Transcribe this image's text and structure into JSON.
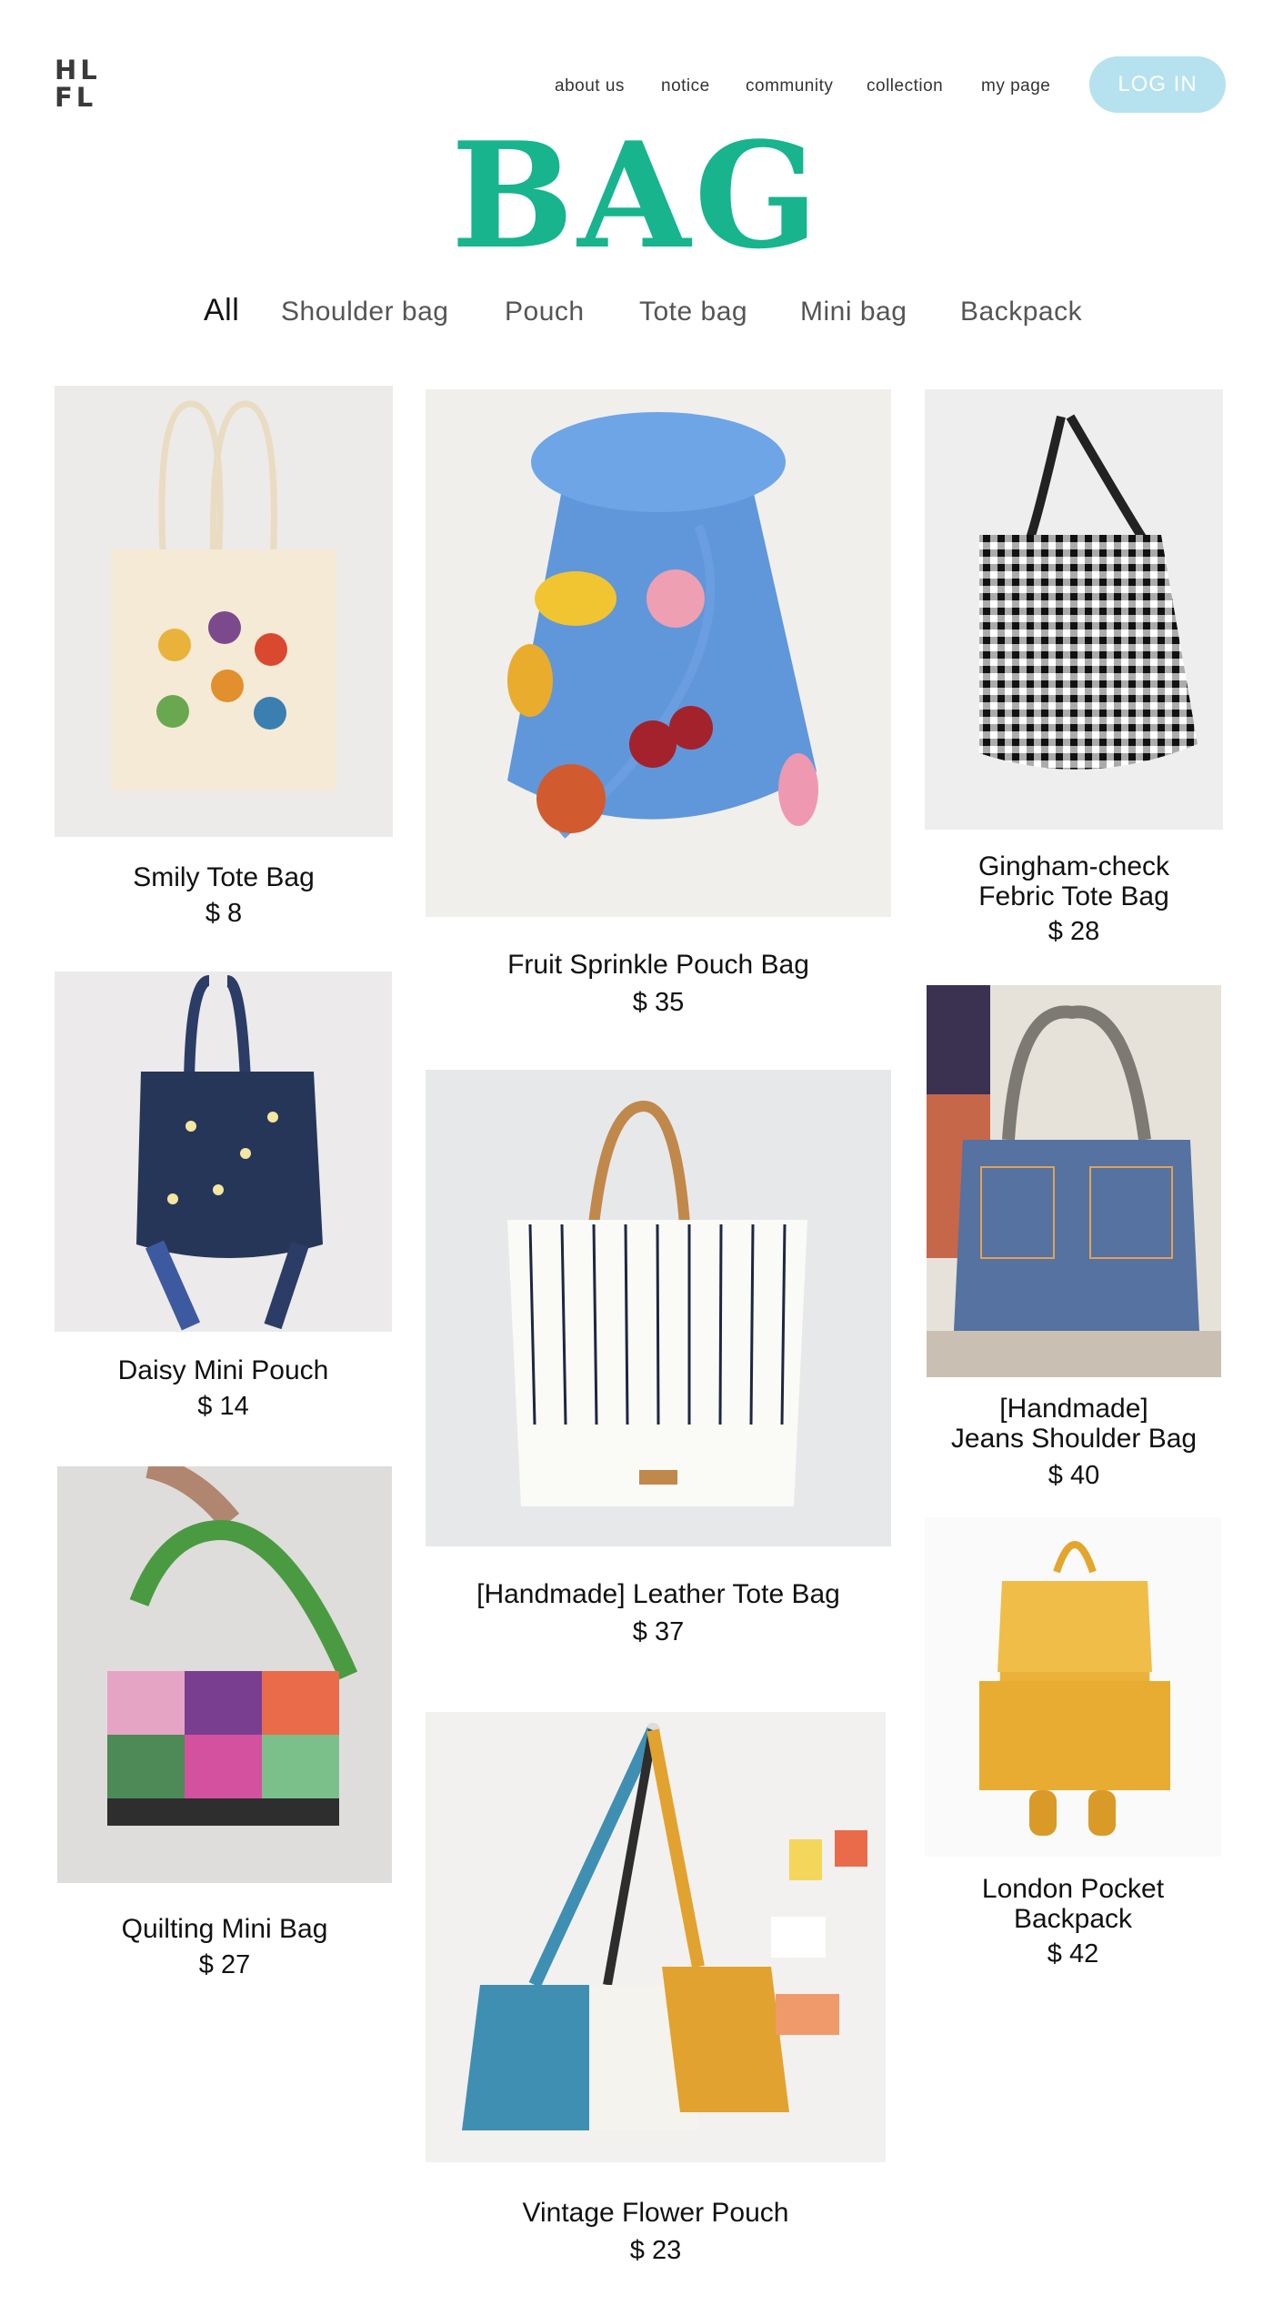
{
  "logo": {
    "line1": "HL",
    "line2": "FL"
  },
  "nav": {
    "items": [
      "about us",
      "notice",
      "community",
      "collection",
      "my page"
    ],
    "login_label": "LOG IN"
  },
  "page_title": "BAG",
  "tabs": [
    "All",
    "Shoulder bag",
    "Pouch",
    "Tote bag",
    "Mini bag",
    "Backpack"
  ],
  "products": [
    {
      "name": "Smily Tote Bag",
      "price": "$ 8"
    },
    {
      "name": "Fruit Sprinkle Pouch Bag",
      "price": "$ 35"
    },
    {
      "name": "Gingham-check\nFebric Tote Bag",
      "price": "$ 28"
    },
    {
      "name": "Daisy Mini Pouch",
      "price": "$ 14"
    },
    {
      "name": "[Handmade] Leather Tote Bag",
      "price": "$ 37"
    },
    {
      "name": "[Handmade]\nJeans Shoulder Bag",
      "price": "$ 40"
    },
    {
      "name": "Quilting Mini Bag",
      "price": "$ 27"
    },
    {
      "name": "Vintage Flower Pouch",
      "price": "$ 23"
    },
    {
      "name": "London Pocket\nBackpack",
      "price": "$ 42"
    }
  ],
  "colors": {
    "title": "#17b48e",
    "login_bg": "#b5e2ee"
  }
}
